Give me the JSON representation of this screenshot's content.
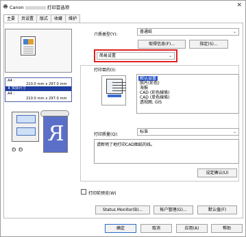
{
  "window": {
    "brand": "Canon",
    "title_suffix": "打印首选项",
    "close_glyph": "✕"
  },
  "tabs": [
    {
      "label": "主要"
    },
    {
      "label": "页设置"
    },
    {
      "label": "版式"
    },
    {
      "label": "收藏"
    },
    {
      "label": "维护"
    }
  ],
  "preview": {
    "size_rows": [
      "A4 :",
      "210.0 mm x 297.0 mm",
      "实际尺寸",
      "A4 :",
      "210.0 mm x 297.0 mm"
    ],
    "highlight_glyph": "⬇",
    "feet_glyph": "ʚ ʚ"
  },
  "media_type": {
    "label": "介质类型(Y):",
    "value": "普通纸"
  },
  "buttons": {
    "get_info": "取得信息(F)...",
    "specify": "指定(S)...",
    "adjust_settings": "设定确认(U)",
    "status_monitor": "Status Monitor(B)...",
    "account_mgmt": "帐户管理(G)...",
    "defaults": "默认值(F)",
    "ok": "确定",
    "cancel": "取消",
    "apply": "应用(A)",
    "help": "帮助"
  },
  "setting_mode": {
    "value": "简易设置"
  },
  "print_purpose": {
    "label": "打印目的(I):",
    "items": [
      "默认设置",
      "照片(彩色)",
      "海报",
      "CAD (彩色線條)",
      "CAD (单色線條)",
      "透视图, GIS"
    ],
    "selected_index": 0
  },
  "print_quality": {
    "label": "打印质量(Q):",
    "value": "标准"
  },
  "description": "请新明了地打印CAD图纸的线。",
  "preview_checkbox": {
    "label": "打印前预览(W)",
    "checked": false
  },
  "colors": {
    "accent": "#2a54c4",
    "highlight_box": "#e02020",
    "preview_blue": "#1f3ea0"
  }
}
